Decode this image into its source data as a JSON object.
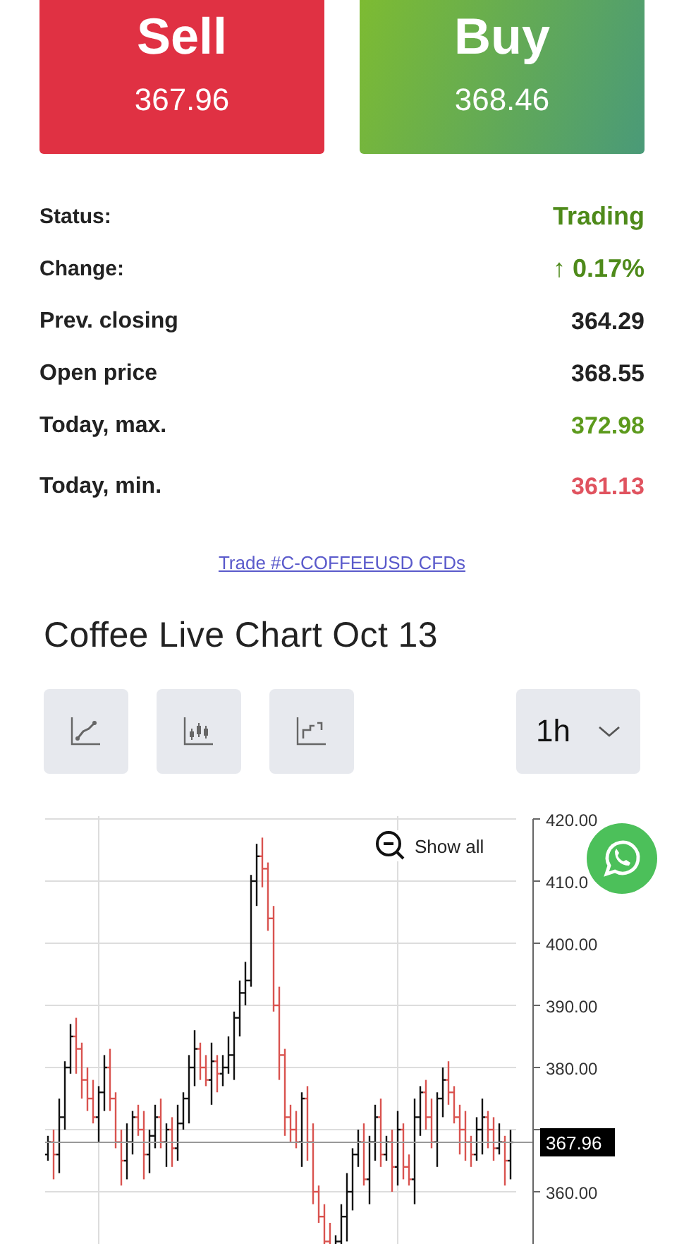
{
  "trade_buttons": [
    {
      "kind": "sell",
      "label": "Sell",
      "price": "367.96"
    },
    {
      "kind": "buy",
      "label": "Buy",
      "price": "368.46"
    }
  ],
  "stats": [
    {
      "label": "Status:",
      "value": "Trading",
      "color": "#4e8a1a",
      "emphasis": true
    },
    {
      "label": "Change:",
      "value": "↑ 0.17%",
      "color": "#4e8a1a",
      "emphasis": true
    },
    {
      "label": "Prev. closing",
      "value": "364.29",
      "color": "#222222",
      "emphasis": false
    },
    {
      "label": "Open price",
      "value": "368.55",
      "color": "#222222",
      "emphasis": false
    },
    {
      "label": "Today, max.",
      "value": "372.98",
      "color": "#5c9a1c",
      "emphasis": false
    },
    {
      "label": "Today, min.",
      "value": "361.13",
      "color": "#e0535f",
      "emphasis": false
    }
  ],
  "trade_link": "Trade #C-COFFEEUSD CFDs",
  "chart_title": "Coffee Live Chart Oct 13",
  "chart_types": [
    {
      "kind": "line"
    },
    {
      "kind": "candles"
    },
    {
      "kind": "steps"
    }
  ],
  "interval": "1h",
  "chart": {
    "show_all": "Show all",
    "axis_labels": [
      "420.00",
      "410.0",
      "400.00",
      "390.00",
      "380.00",
      "360.00"
    ],
    "price_tag": "367.96"
  }
}
